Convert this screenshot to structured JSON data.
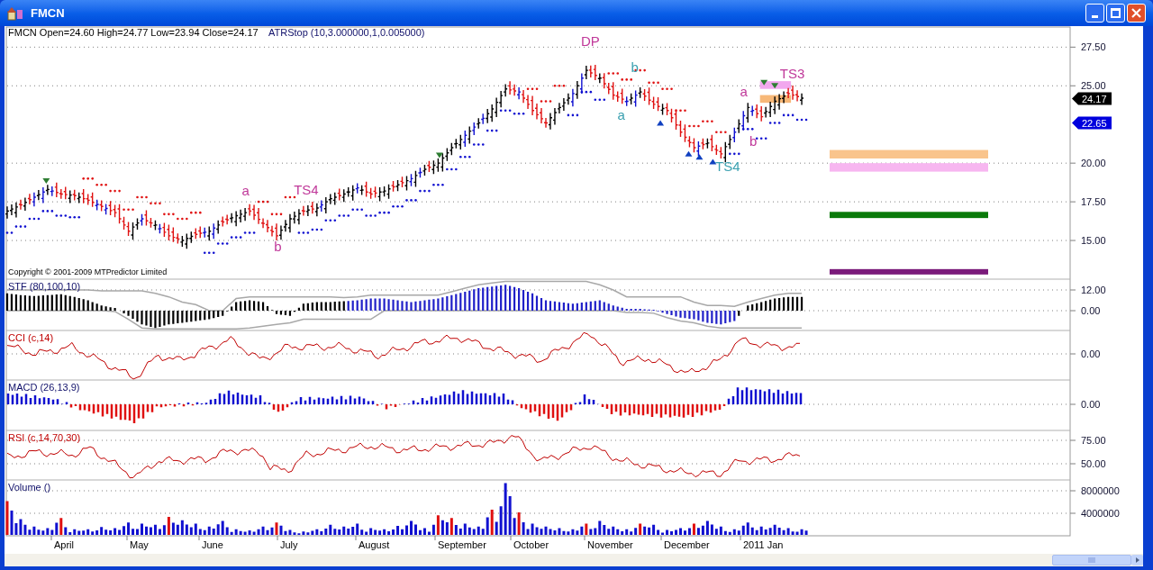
{
  "window": {
    "title": "FMCN"
  },
  "header": {
    "quote": "FMCN Open=24.60 High=24.77 Low=23.94 Close=24.17",
    "indicator": "ATRStop (10,3.000000,1,0.005000)"
  },
  "copyright": "Copyright © 2001-2009 MTPredictor Limited",
  "price_panel": {
    "axis_labels": [
      "27.50",
      "25.00",
      "20.00",
      "17.50",
      "15.00"
    ],
    "wave_labels": [
      {
        "text": "a",
        "color": "#c0399a"
      },
      {
        "text": "b",
        "color": "#c0399a"
      },
      {
        "text": "TS4",
        "color": "#c0399a"
      },
      {
        "text": "DP",
        "color": "#c0399a"
      },
      {
        "text": "a",
        "color": "#3aa0b0"
      },
      {
        "text": "b",
        "color": "#3aa0b0"
      },
      {
        "text": "TS4",
        "color": "#3aa0b0"
      },
      {
        "text": "a",
        "color": "#c0399a"
      },
      {
        "text": "b",
        "color": "#c0399a"
      },
      {
        "text": "TS3",
        "color": "#c0399a"
      }
    ],
    "price_tags": [
      {
        "text": "24.17",
        "color": "#000000"
      },
      {
        "text": "22.65",
        "color": "#0000dd"
      }
    ]
  },
  "panels": [
    {
      "kind": "oscillator",
      "title": "STF (80,100,10)",
      "axis_labels": [
        "12.00",
        "0.00"
      ]
    },
    {
      "kind": "line",
      "title": "CCI (c,14)",
      "axis_labels": [
        "0.00"
      ]
    },
    {
      "kind": "histogram",
      "title": "MACD (26,13,9)",
      "axis_labels": [
        "0.00"
      ]
    },
    {
      "kind": "line",
      "title": "RSI (c,14,70,30)",
      "axis_labels": [
        "75.00",
        "50.00"
      ]
    },
    {
      "kind": "volume",
      "title": "Volume ()",
      "axis_labels": [
        "8000000",
        "4000000"
      ]
    }
  ],
  "months": [
    "April",
    "May",
    "June",
    "July",
    "August",
    "September",
    "October",
    "November",
    "December",
    "2011 Jan"
  ]
}
